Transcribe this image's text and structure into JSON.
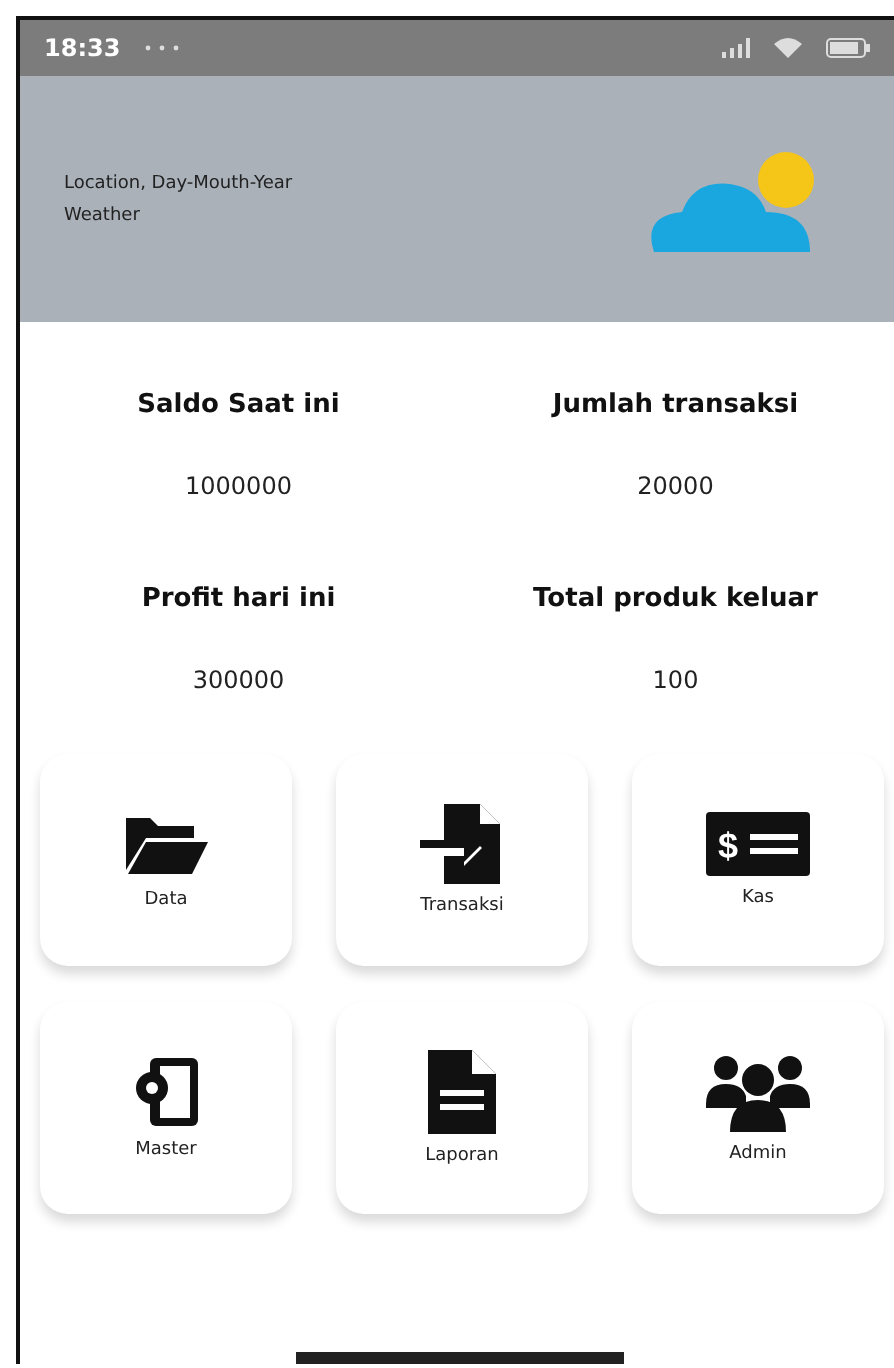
{
  "status_bar": {
    "time": "18:33"
  },
  "header": {
    "location_line": "Location, Day-Mouth-Year",
    "weather_line": "Weather"
  },
  "stats": [
    {
      "label": "Saldo Saat ini",
      "value": "1000000"
    },
    {
      "label": "Jumlah transaksi",
      "value": "20000"
    },
    {
      "label": "Profit hari ini",
      "value": "300000"
    },
    {
      "label": "Total produk keluar",
      "value": "100"
    }
  ],
  "menu": [
    {
      "label": "Data"
    },
    {
      "label": "Transaksi"
    },
    {
      "label": "Kas",
      "symbol": "$"
    },
    {
      "label": "Master"
    },
    {
      "label": "Laporan"
    },
    {
      "label": "Admin"
    }
  ]
}
